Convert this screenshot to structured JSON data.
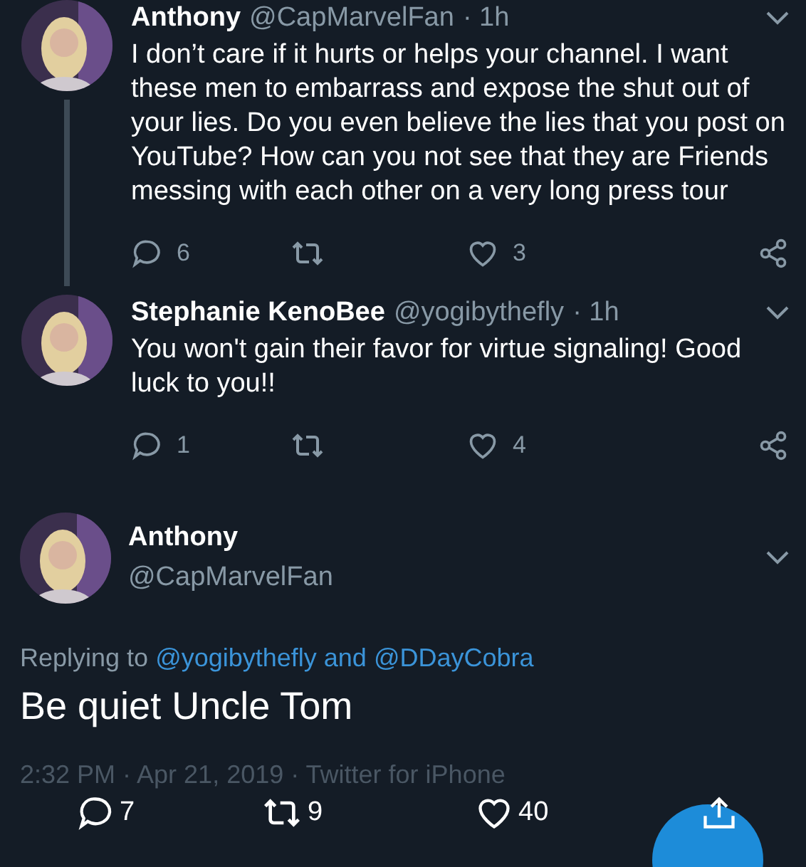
{
  "tweets": [
    {
      "name": "Anthony",
      "handle": "@CapMarvelFan",
      "time": "· 1h",
      "thread_line": true,
      "text": "I don’t care if it hurts or helps your channel. I want these men to embarrass and expose the shut out of your lies. Do you even believe the lies that you post on YouTube? How can you not see that they are Friends messing with each other on a very long press tour",
      "replies": "6",
      "likes": "3"
    },
    {
      "name": "Stephanie KenoBee",
      "handle": "@yogibythefly",
      "time": "· 1h",
      "thread_line": false,
      "text": "You won't gain their favor for virtue signaling! Good luck to you!!",
      "replies": "1",
      "likes": "4"
    }
  ],
  "main": {
    "name": "Anthony",
    "handle": "@CapMarvelFan",
    "replying_prefix": "Replying to",
    "replying_to": "@yogibythefly and @DDayCobra",
    "text": "Be quiet Uncle Tom",
    "timestamp": "2:32 PM · Apr 21, 2019 · Twitter for iPhone",
    "replies": "7",
    "retweets": "9",
    "likes": "40"
  }
}
